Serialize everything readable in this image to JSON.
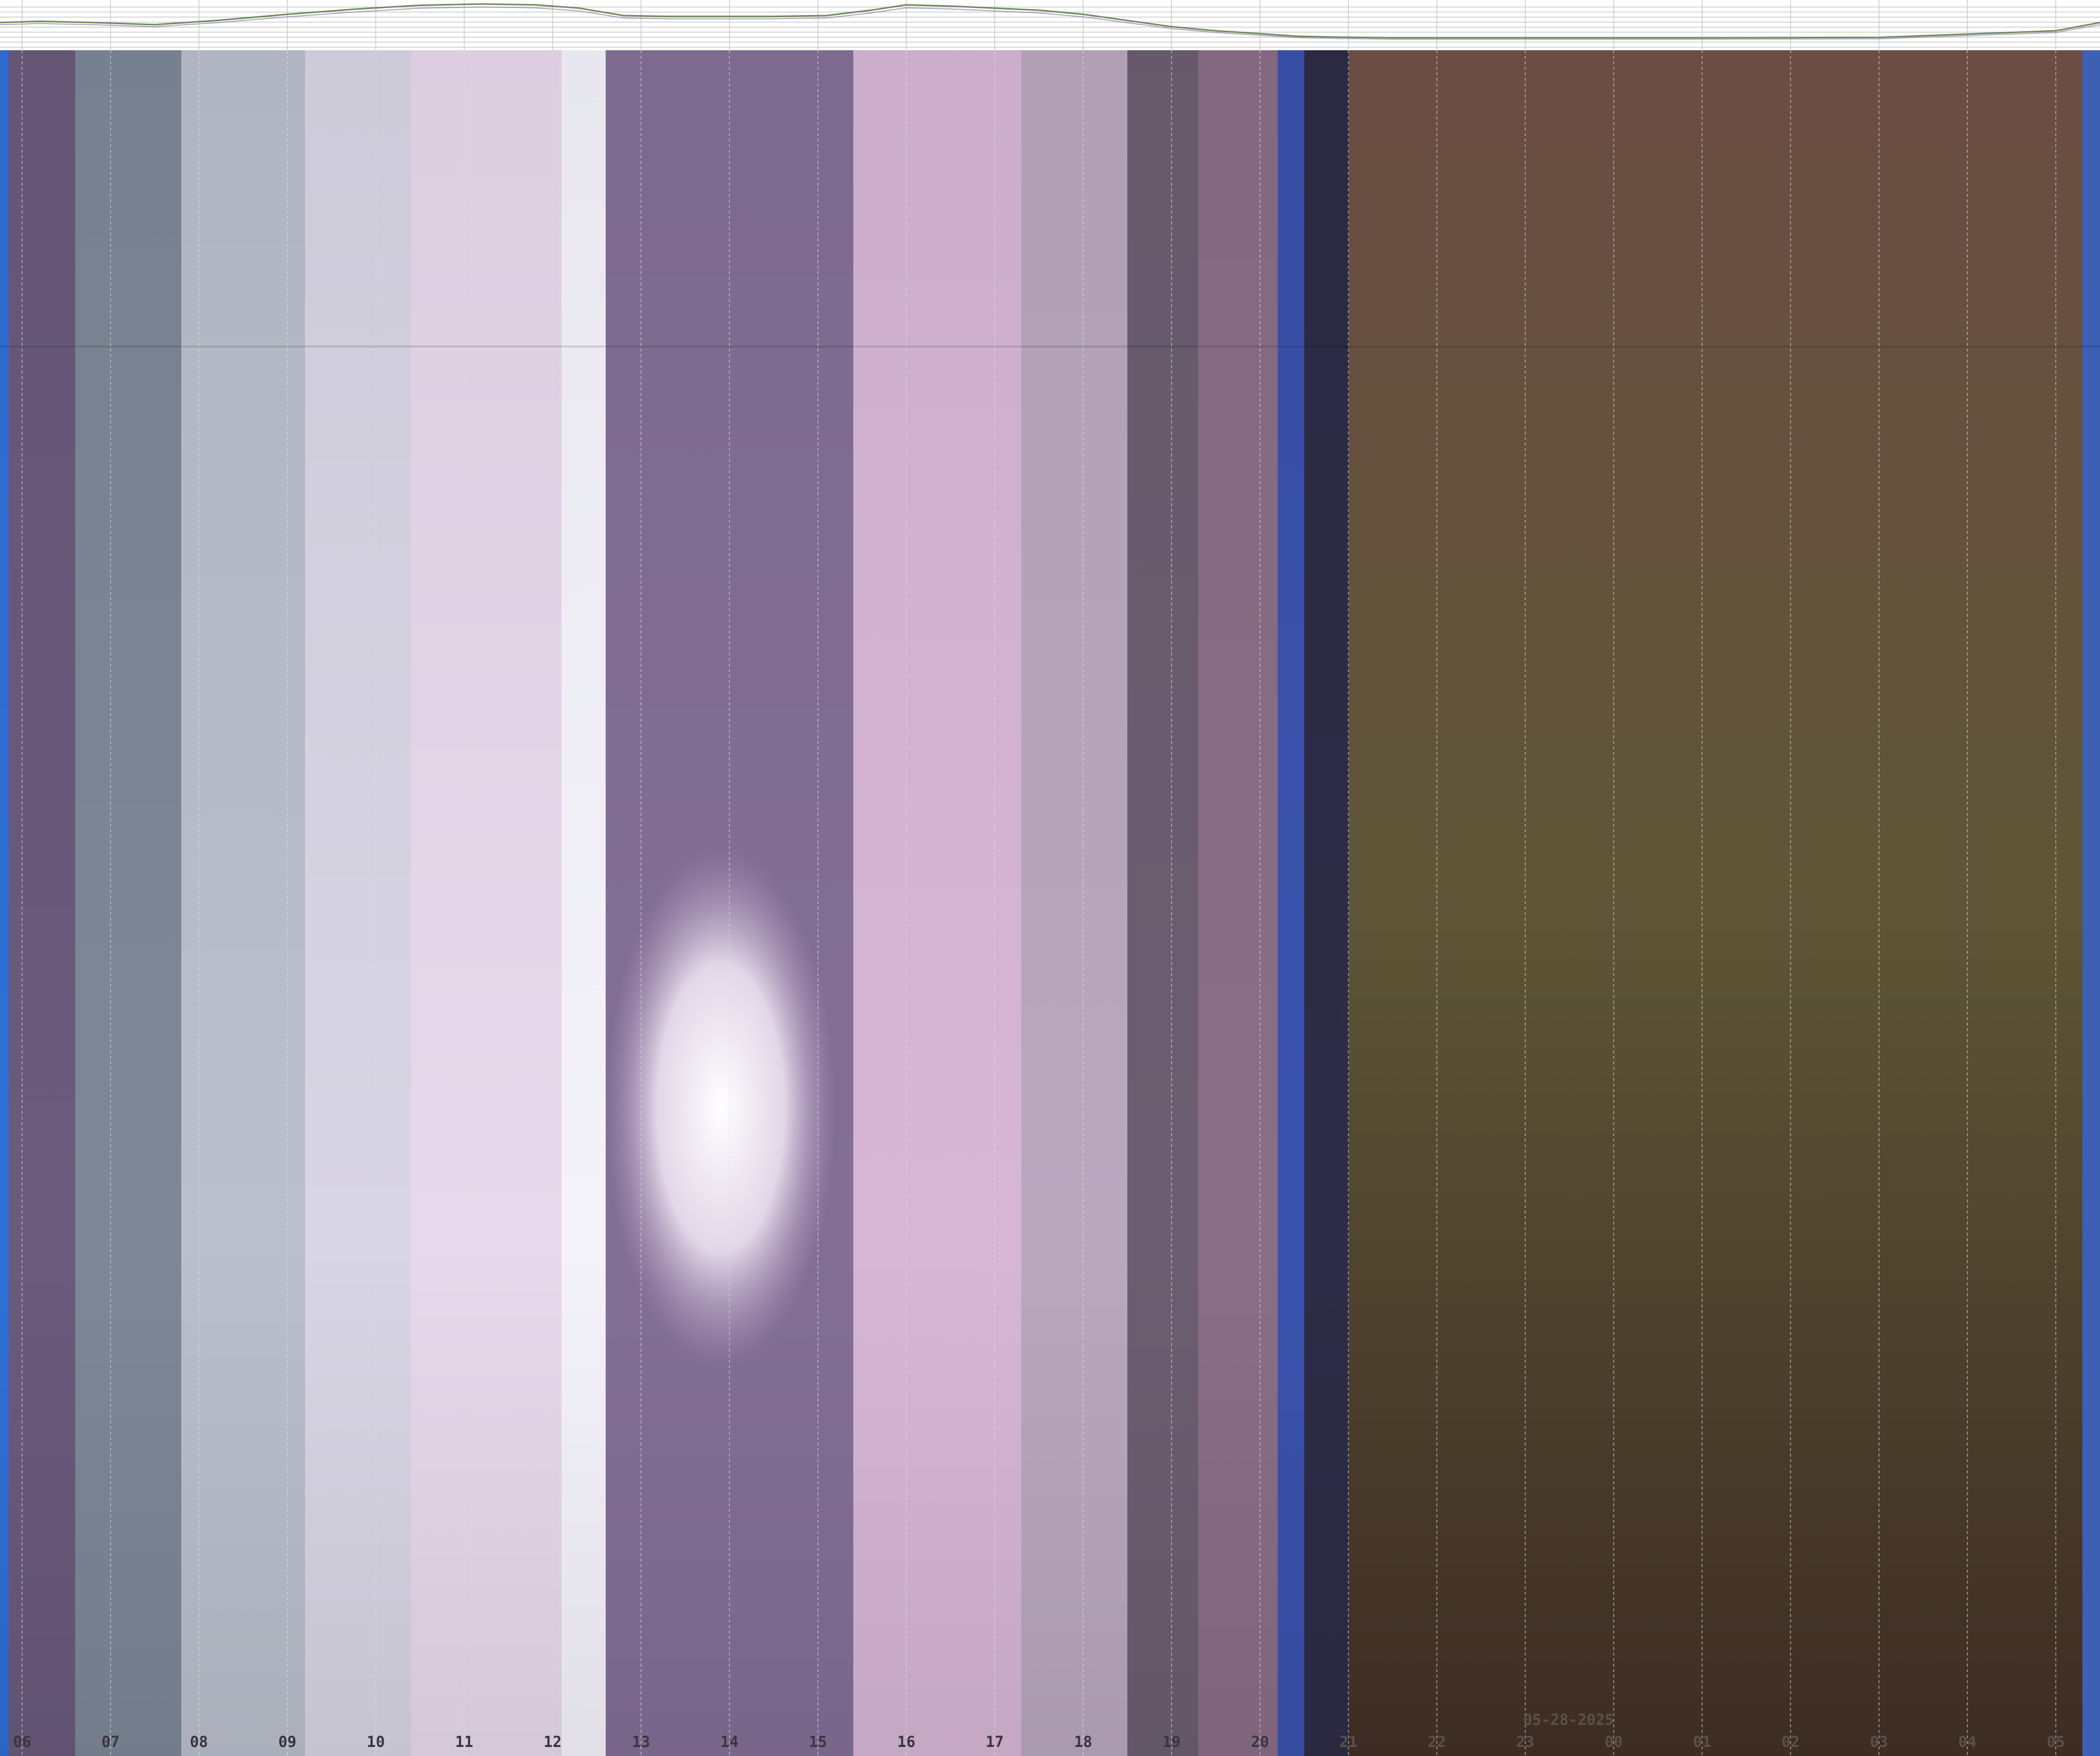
{
  "chart_data": {
    "type": "heatmap",
    "title": "",
    "date_label": "05-28-2025",
    "x_tick_labels": [
      "06",
      "07",
      "08",
      "09",
      "10",
      "11",
      "12",
      "13",
      "14",
      "15",
      "16",
      "17",
      "18",
      "19",
      "20",
      "21",
      "22",
      "23",
      "00",
      "01",
      "02",
      "03",
      "04",
      "05"
    ],
    "x_ticks_hours": [
      6,
      7,
      8,
      9,
      10,
      11,
      12,
      13,
      14,
      15,
      16,
      17,
      18,
      19,
      20,
      21,
      22,
      23,
      24,
      25,
      26,
      27,
      28,
      29
    ],
    "x_range_hours": [
      5.75,
      29.5
    ],
    "day_bands": [
      {
        "from": 5.75,
        "to": 5.85,
        "color": "#2f6fd6"
      },
      {
        "from": 5.85,
        "to": 6.6,
        "color": "#6a5a7c"
      },
      {
        "from": 6.6,
        "to": 7.8,
        "color": "#7d8797"
      },
      {
        "from": 7.8,
        "to": 9.2,
        "color": "#b9bfcb"
      },
      {
        "from": 9.2,
        "to": 10.4,
        "color": "#d8d5e4"
      },
      {
        "from": 10.4,
        "to": 12.1,
        "color": "#e7d9eb"
      },
      {
        "from": 12.1,
        "to": 12.6,
        "color": "#f4f3fb"
      },
      {
        "from": 12.6,
        "to": 15.4,
        "color": "#836f96"
      },
      {
        "from": 15.4,
        "to": 17.3,
        "color": "#d6b6d4"
      },
      {
        "from": 17.3,
        "to": 18.5,
        "color": "#b9a7be"
      },
      {
        "from": 18.5,
        "to": 19.3,
        "color": "#6b5e70"
      },
      {
        "from": 19.3,
        "to": 20.2,
        "color": "#8a6d86"
      },
      {
        "from": 20.2,
        "to": 20.5,
        "color": "#3b52ad"
      },
      {
        "from": 20.5,
        "to": 21.0,
        "color": "#2e2c46"
      }
    ],
    "night_gradient": {
      "top": "#6b4d44",
      "middle": "#5e5636",
      "bottom": "#3d2c24"
    },
    "dawn_edge": {
      "from": 29.3,
      "to": 29.5,
      "color": "#3d5fb4"
    },
    "sun_position_hour": 13.9,
    "brightness_trace": {
      "hours": [
        5.75,
        6.2,
        6.8,
        7.5,
        8.2,
        9.0,
        9.8,
        10.5,
        11.2,
        11.8,
        12.3,
        12.8,
        13.3,
        13.8,
        14.5,
        15.1,
        15.6,
        16.0,
        16.5,
        17.0,
        17.5,
        18.0,
        18.5,
        19.0,
        19.5,
        20.0,
        20.4,
        20.8,
        21.5,
        23,
        25,
        27,
        29.0,
        29.5
      ],
      "values": [
        0.55,
        0.58,
        0.55,
        0.5,
        0.6,
        0.75,
        0.88,
        0.97,
        1.0,
        0.98,
        0.9,
        0.72,
        0.7,
        0.7,
        0.7,
        0.72,
        0.85,
        0.98,
        0.95,
        0.9,
        0.85,
        0.75,
        0.6,
        0.45,
        0.35,
        0.28,
        0.22,
        0.2,
        0.18,
        0.18,
        0.18,
        0.19,
        0.35,
        0.55
      ]
    }
  }
}
